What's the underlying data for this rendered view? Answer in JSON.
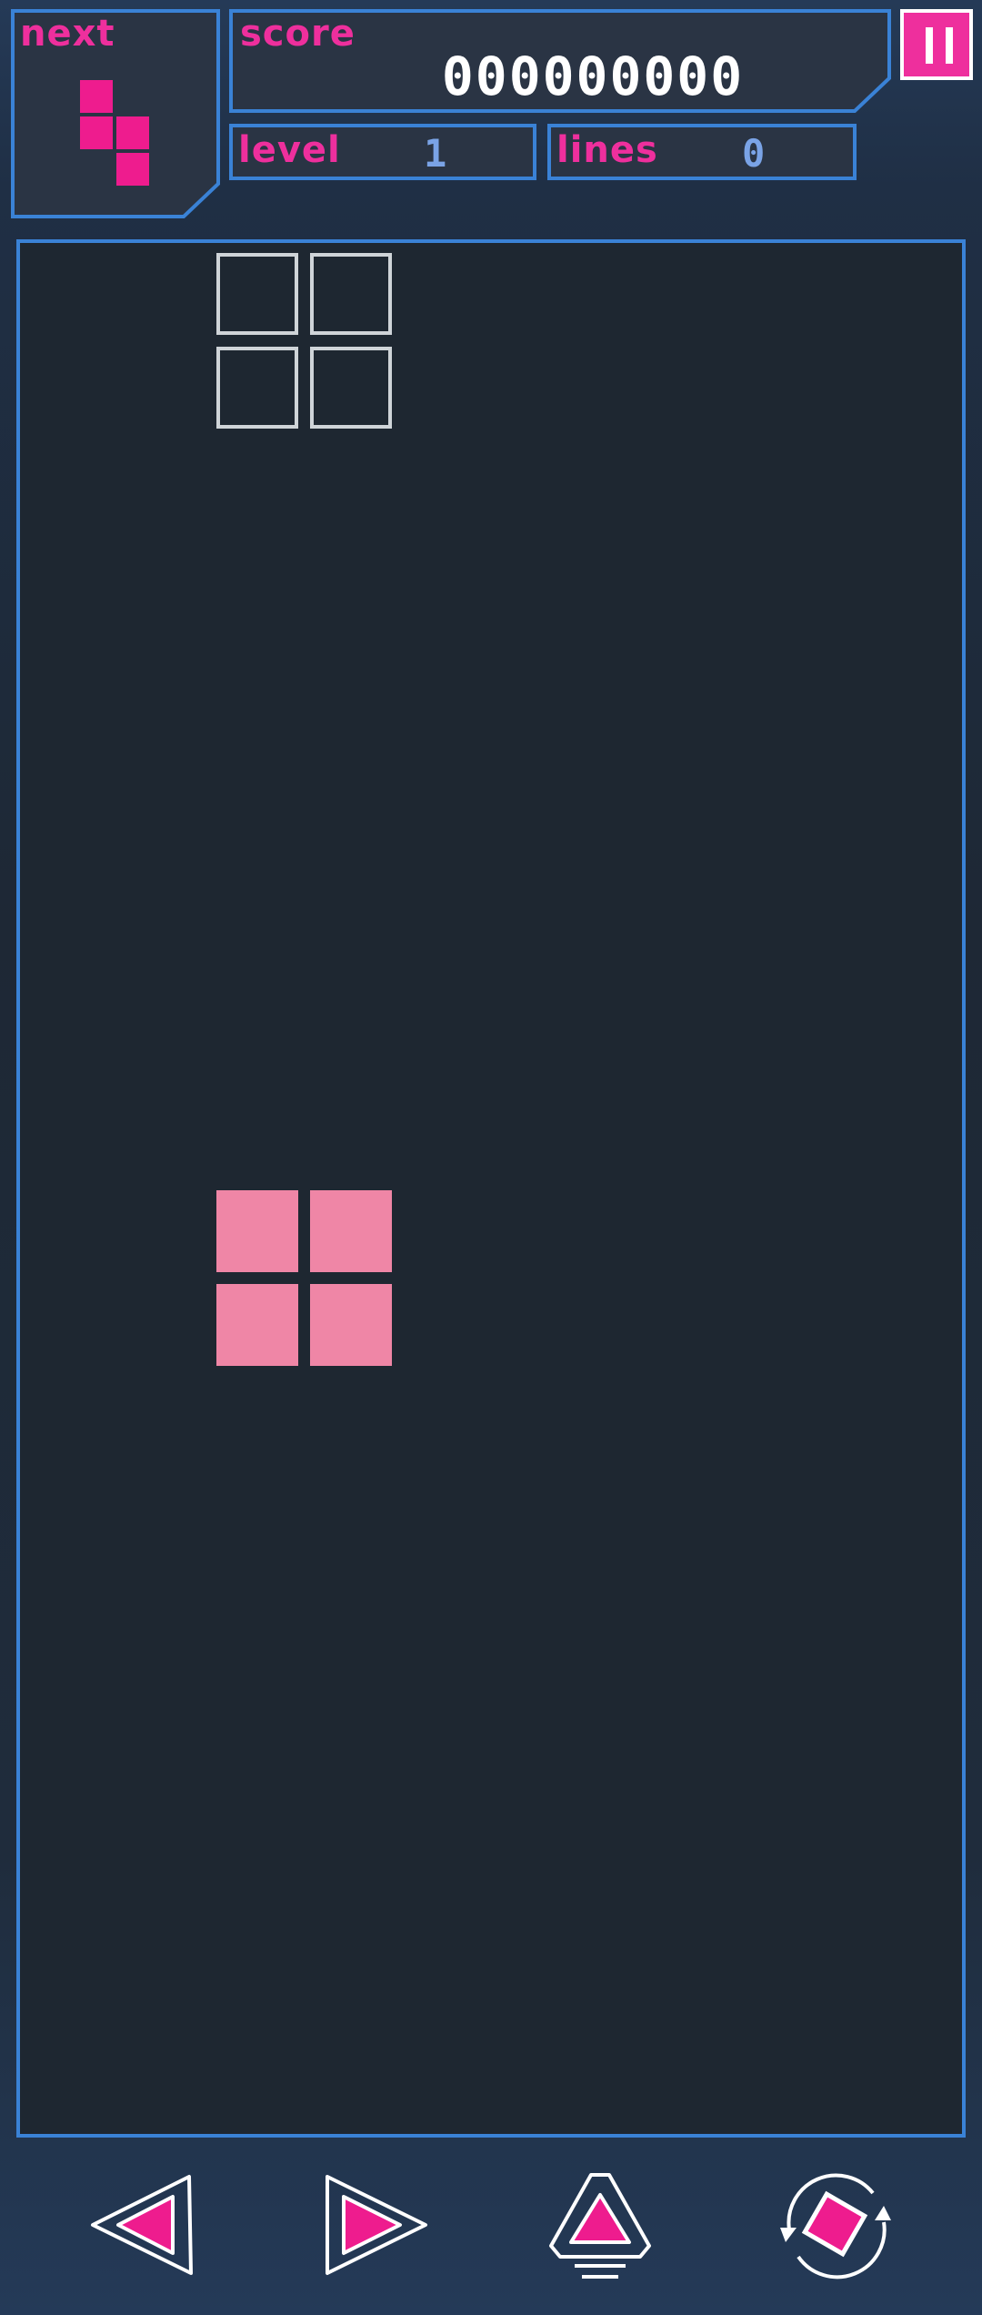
{
  "hud": {
    "next_label": "next",
    "score_label": "score",
    "score_value": "000000000",
    "level_label": "level",
    "level_value": "1",
    "lines_label": "lines",
    "lines_value": "0"
  },
  "colors": {
    "accent": "#ee2f9d",
    "border": "#3a82d6",
    "board_bg": "#1e2731",
    "piece": "#ef86a6",
    "ghost": "#cfd4d8",
    "value_blue": "#7aa3e6"
  },
  "next_piece": {
    "shape": "S-vertical",
    "color": "#ee1c8e"
  },
  "active_piece": {
    "shape": "O",
    "color": "#ef86a6"
  },
  "ghost_piece": {
    "shape": "O"
  },
  "controls": [
    {
      "name": "move-left",
      "icon": "left-triangle-icon"
    },
    {
      "name": "move-right",
      "icon": "right-triangle-icon"
    },
    {
      "name": "hard-drop",
      "icon": "drop-triangle-icon"
    },
    {
      "name": "rotate",
      "icon": "rotate-icon"
    }
  ]
}
